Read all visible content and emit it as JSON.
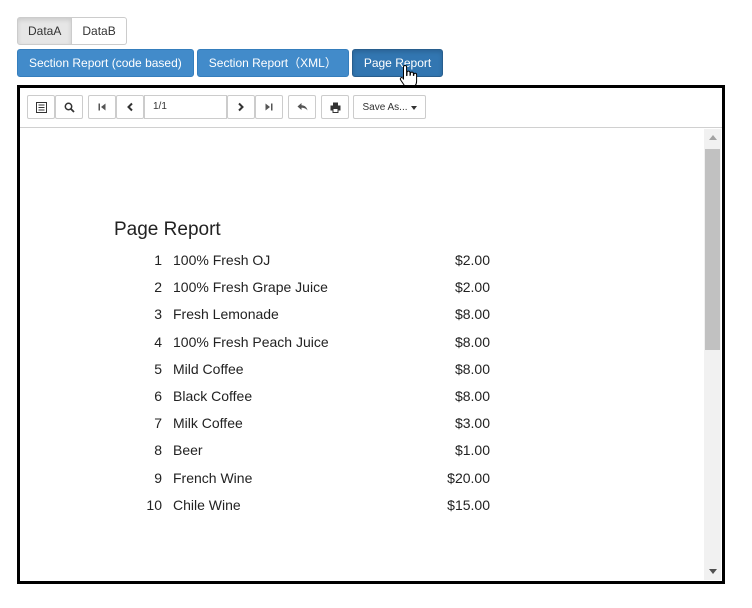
{
  "data_toggle": {
    "option_a": "DataA",
    "option_b": "DataB"
  },
  "report_buttons": {
    "section_code": "Section Report (code based)",
    "section_xml": "Section Report（XML）",
    "page_report": "Page Report"
  },
  "toolbar": {
    "page_value": "1/1",
    "save_as_label": "Save As..."
  },
  "report": {
    "title": "Page Report",
    "items": [
      {
        "num": "1",
        "name": "100% Fresh OJ",
        "price": "$2.00"
      },
      {
        "num": "2",
        "name": "100% Fresh Grape Juice",
        "price": "$2.00"
      },
      {
        "num": "3",
        "name": "Fresh Lemonade",
        "price": "$8.00"
      },
      {
        "num": "4",
        "name": "100% Fresh Peach Juice",
        "price": "$8.00"
      },
      {
        "num": "5",
        "name": "Mild Coffee",
        "price": "$8.00"
      },
      {
        "num": "6",
        "name": "Black Coffee",
        "price": "$8.00"
      },
      {
        "num": "7",
        "name": "Milk Coffee",
        "price": "$3.00"
      },
      {
        "num": "8",
        "name": "Beer",
        "price": "$1.00"
      },
      {
        "num": "9",
        "name": "French Wine",
        "price": "$20.00"
      },
      {
        "num": "10",
        "name": "Chile Wine",
        "price": "$15.00"
      }
    ]
  },
  "colors": {
    "primary": "#428bca",
    "primary_active": "#3276b1",
    "frame": "#000000"
  },
  "icons": [
    "toc-icon",
    "search-icon",
    "first-page-icon",
    "prev-page-icon",
    "next-page-icon",
    "last-page-icon",
    "back-icon",
    "print-icon"
  ]
}
